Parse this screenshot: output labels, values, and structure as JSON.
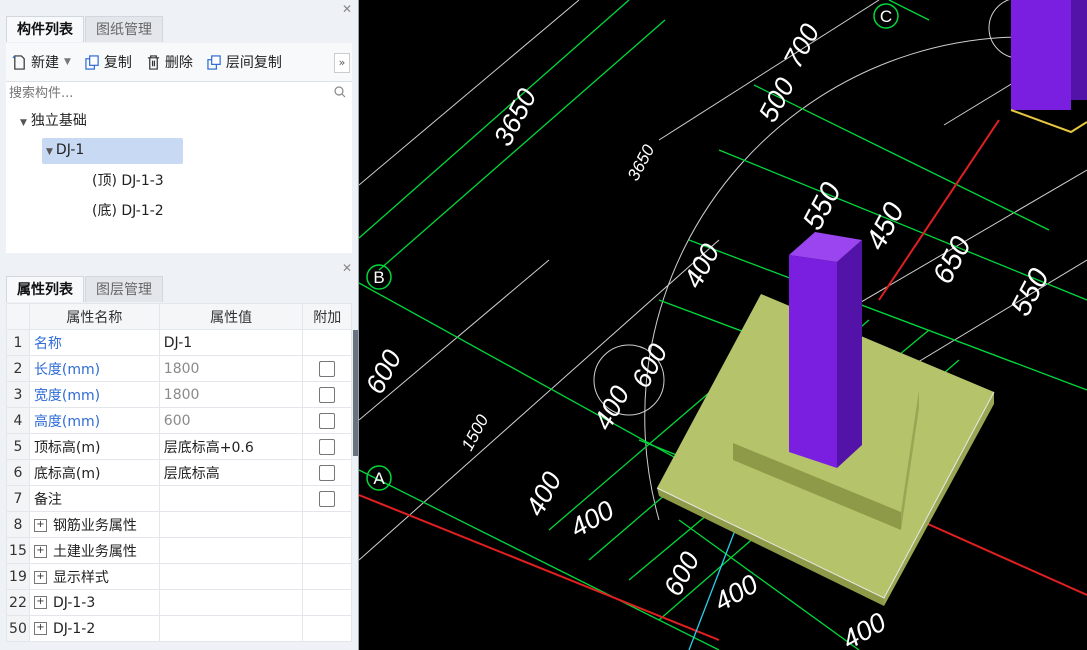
{
  "component_panel": {
    "tabs": [
      "构件列表",
      "图纸管理"
    ],
    "toolbar": {
      "new": "新建",
      "copy": "复制",
      "delete": "删除",
      "floor_copy": "层间复制",
      "more": "»"
    },
    "search_placeholder": "搜索构件...",
    "tree": {
      "category": "独立基础",
      "item": "DJ-1",
      "children": [
        "(顶) DJ-1-3",
        "(底) DJ-1-2"
      ]
    }
  },
  "property_panel": {
    "tabs": [
      "属性列表",
      "图层管理"
    ],
    "headers": [
      "属性名称",
      "属性值",
      "附加"
    ],
    "rows": [
      {
        "idx": "1",
        "name": "名称",
        "value": "DJ-1"
      },
      {
        "idx": "2",
        "name": "长度(mm)",
        "value": "1800"
      },
      {
        "idx": "3",
        "name": "宽度(mm)",
        "value": "1800"
      },
      {
        "idx": "4",
        "name": "高度(mm)",
        "value": "600"
      },
      {
        "idx": "5",
        "name": "顶标高(m)",
        "value": "层底标高+0.6"
      },
      {
        "idx": "6",
        "name": "底标高(m)",
        "value": "层底标高"
      },
      {
        "idx": "7",
        "name": "备注",
        "value": ""
      },
      {
        "idx": "8",
        "name": "钢筋业务属性",
        "value": ""
      },
      {
        "idx": "15",
        "name": "土建业务属性",
        "value": ""
      },
      {
        "idx": "19",
        "name": "显示样式",
        "value": ""
      },
      {
        "idx": "22",
        "name": "DJ-1-3",
        "value": ""
      },
      {
        "idx": "50",
        "name": "DJ-1-2",
        "value": ""
      }
    ]
  },
  "drawing": {
    "axis_labels": [
      "C",
      "B",
      "A"
    ],
    "dims": [
      "3650",
      "3650",
      "1500",
      "700",
      "500",
      "550",
      "450",
      "650",
      "550",
      "400",
      "600",
      "400",
      "400",
      "400",
      "600",
      "400",
      "400",
      "600"
    ],
    "colors": {
      "footing": "#b5c46b",
      "column": "#7a1fe0",
      "grid": "#00d83a",
      "axis": "#e02020"
    }
  }
}
